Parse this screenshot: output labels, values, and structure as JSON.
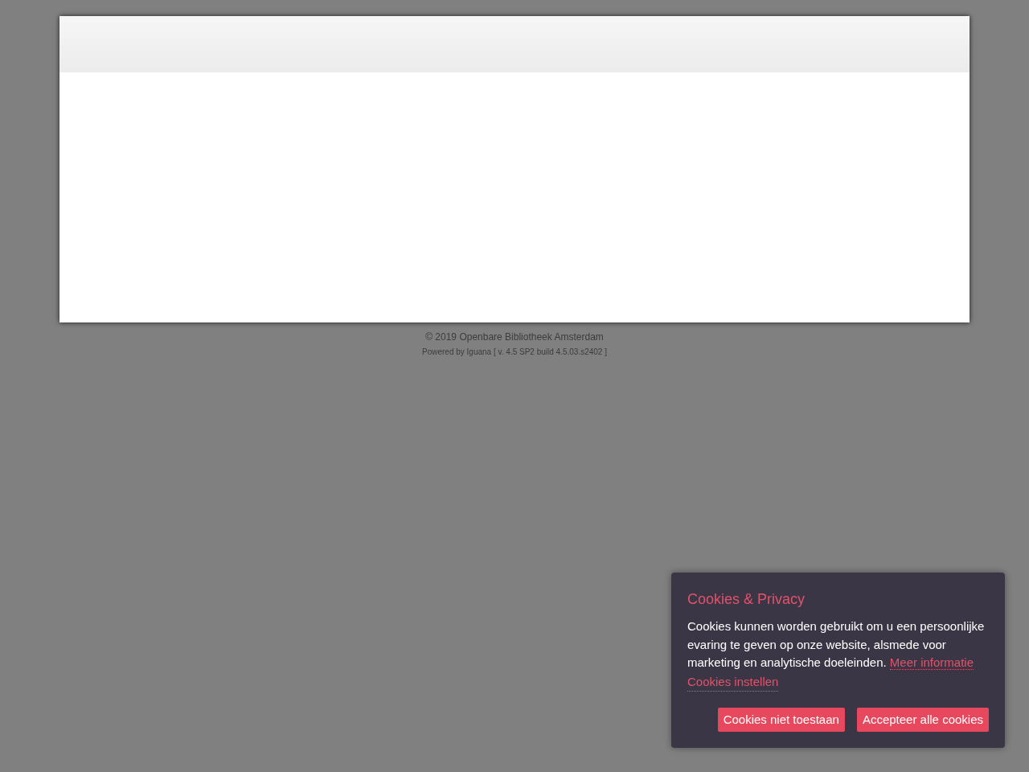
{
  "footer": {
    "copyright": "© 2019 Openbare Bibliotheek Amsterdam",
    "powered_by": "Powered by Iguana [ v. 4.5 SP2 build 4.5.03.s2402 ]"
  },
  "cookie_dialog": {
    "title": "Cookies & Privacy",
    "text": "Cookies kunnen worden gebruikt om u een persoonlijke evaring te geven op onze website, alsmede voor marketing en analytische doeleinden.",
    "more_info_link": "Meer informatie",
    "settings_link": "Cookies instellen",
    "buttons": [
      "Cookies niet toestaan",
      "Accepteer alle cookies"
    ]
  }
}
